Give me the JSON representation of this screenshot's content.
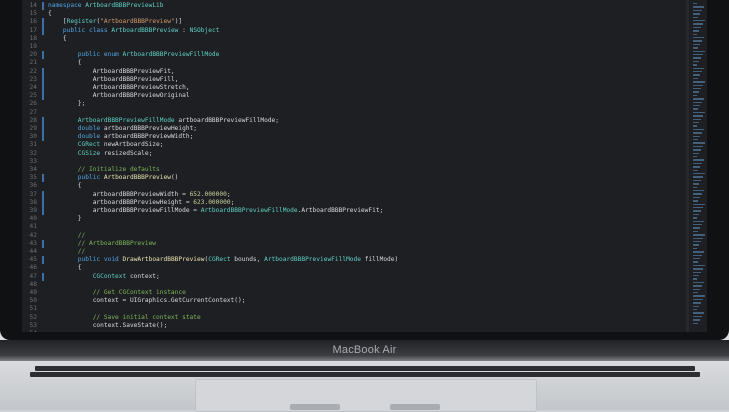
{
  "device": {
    "label": "MacBook Air"
  },
  "editor": {
    "lines": [
      {
        "n": "14",
        "marker": true,
        "segs": [
          {
            "t": "namespace ",
            "c": "kw"
          },
          {
            "t": "ArtboardBBBPreviewLib",
            "c": "ty"
          }
        ]
      },
      {
        "n": "15",
        "marker": false,
        "segs": [
          {
            "t": "{",
            "c": ""
          }
        ]
      },
      {
        "n": "16",
        "marker": true,
        "segs": [
          {
            "t": "    [",
            "c": ""
          },
          {
            "t": "Register",
            "c": "ty"
          },
          {
            "t": "(",
            "c": ""
          },
          {
            "t": "\"ArtboardBBBPreview\"",
            "c": "st"
          },
          {
            "t": ")]",
            "c": ""
          }
        ]
      },
      {
        "n": "17",
        "marker": true,
        "segs": [
          {
            "t": "    public class ",
            "c": "kw"
          },
          {
            "t": "ArtboardBBBPreview",
            "c": "ty"
          },
          {
            "t": " : ",
            "c": ""
          },
          {
            "t": "NSObject",
            "c": "ty"
          }
        ]
      },
      {
        "n": "18",
        "marker": false,
        "segs": [
          {
            "t": "    {",
            "c": ""
          }
        ]
      },
      {
        "n": "19",
        "marker": false,
        "segs": []
      },
      {
        "n": "20",
        "marker": true,
        "segs": [
          {
            "t": "        public enum ",
            "c": "kw"
          },
          {
            "t": "ArtboardBBBPreviewFillMode",
            "c": "ty"
          }
        ]
      },
      {
        "n": "21",
        "marker": false,
        "segs": [
          {
            "t": "        {",
            "c": ""
          }
        ]
      },
      {
        "n": "22",
        "marker": true,
        "segs": [
          {
            "t": "            ArtboardBBBPreviewFit,",
            "c": ""
          }
        ]
      },
      {
        "n": "23",
        "marker": true,
        "segs": [
          {
            "t": "            ArtboardBBBPreviewFill,",
            "c": ""
          }
        ]
      },
      {
        "n": "24",
        "marker": true,
        "segs": [
          {
            "t": "            ArtboardBBBPreviewStretch,",
            "c": ""
          }
        ]
      },
      {
        "n": "25",
        "marker": true,
        "segs": [
          {
            "t": "            ArtboardBBBPreviewOriginal",
            "c": ""
          }
        ]
      },
      {
        "n": "26",
        "marker": false,
        "segs": [
          {
            "t": "        };",
            "c": ""
          }
        ]
      },
      {
        "n": "27",
        "marker": false,
        "segs": []
      },
      {
        "n": "28",
        "marker": true,
        "segs": [
          {
            "t": "        ArtboardBBBPreviewFillMode",
            "c": "ty"
          },
          {
            "t": " artboardBBBPreviewFillMode;",
            "c": ""
          }
        ]
      },
      {
        "n": "29",
        "marker": true,
        "segs": [
          {
            "t": "        double ",
            "c": "kw"
          },
          {
            "t": "artboardBBBPreviewHeight;",
            "c": ""
          }
        ]
      },
      {
        "n": "30",
        "marker": true,
        "segs": [
          {
            "t": "        double ",
            "c": "kw"
          },
          {
            "t": "artboardBBBPreviewWidth;",
            "c": ""
          }
        ]
      },
      {
        "n": "31",
        "marker": false,
        "segs": [
          {
            "t": "        CGRect",
            "c": "ty"
          },
          {
            "t": " newArtboardSize;",
            "c": ""
          }
        ]
      },
      {
        "n": "32",
        "marker": false,
        "segs": [
          {
            "t": "        CGSize",
            "c": "ty"
          },
          {
            "t": " resizedScale;",
            "c": ""
          }
        ]
      },
      {
        "n": "33",
        "marker": false,
        "segs": []
      },
      {
        "n": "34",
        "marker": false,
        "segs": [
          {
            "t": "        // Initialize defaults",
            "c": "cm"
          }
        ]
      },
      {
        "n": "35",
        "marker": true,
        "segs": [
          {
            "t": "        public ",
            "c": "kw"
          },
          {
            "t": "ArtboardBBBPreview",
            "c": "fn"
          },
          {
            "t": "()",
            "c": ""
          }
        ]
      },
      {
        "n": "36",
        "marker": false,
        "segs": [
          {
            "t": "        {",
            "c": ""
          }
        ]
      },
      {
        "n": "37",
        "marker": true,
        "segs": [
          {
            "t": "            artboardBBBPreviewWidth = ",
            "c": ""
          },
          {
            "t": "652.000000",
            "c": "nm"
          },
          {
            "t": ";",
            "c": ""
          }
        ]
      },
      {
        "n": "38",
        "marker": true,
        "segs": [
          {
            "t": "            artboardBBBPreviewHeight = ",
            "c": ""
          },
          {
            "t": "623.000000",
            "c": "nm"
          },
          {
            "t": ";",
            "c": ""
          }
        ]
      },
      {
        "n": "39",
        "marker": true,
        "segs": [
          {
            "t": "            artboardBBBPreviewFillMode = ",
            "c": ""
          },
          {
            "t": "ArtboardBBBPreviewFillMode",
            "c": "ty"
          },
          {
            "t": ".ArtboardBBBPreviewFit;",
            "c": ""
          }
        ]
      },
      {
        "n": "40",
        "marker": false,
        "segs": [
          {
            "t": "        }",
            "c": ""
          }
        ]
      },
      {
        "n": "41",
        "marker": false,
        "segs": []
      },
      {
        "n": "42",
        "marker": false,
        "segs": [
          {
            "t": "        //",
            "c": "cm"
          }
        ]
      },
      {
        "n": "43",
        "marker": true,
        "segs": [
          {
            "t": "        // ArtboardBBBPreview",
            "c": "cm"
          }
        ]
      },
      {
        "n": "44",
        "marker": false,
        "segs": [
          {
            "t": "        //",
            "c": "cm"
          }
        ]
      },
      {
        "n": "45",
        "marker": true,
        "segs": [
          {
            "t": "        public void ",
            "c": "kw"
          },
          {
            "t": "DrawArtboardBBBPreview",
            "c": "fn"
          },
          {
            "t": "(",
            "c": ""
          },
          {
            "t": "CGRect",
            "c": "ty"
          },
          {
            "t": " bounds, ",
            "c": ""
          },
          {
            "t": "ArtboardBBBPreviewFillMode",
            "c": "ty"
          },
          {
            "t": " fillMode)",
            "c": ""
          }
        ]
      },
      {
        "n": "46",
        "marker": false,
        "segs": [
          {
            "t": "        {",
            "c": ""
          }
        ]
      },
      {
        "n": "47",
        "marker": true,
        "segs": [
          {
            "t": "            CGContext",
            "c": "ty"
          },
          {
            "t": " context;",
            "c": ""
          }
        ]
      },
      {
        "n": "48",
        "marker": false,
        "segs": []
      },
      {
        "n": "49",
        "marker": false,
        "segs": [
          {
            "t": "            // Get CGContext instance",
            "c": "cm"
          }
        ]
      },
      {
        "n": "50",
        "marker": false,
        "segs": [
          {
            "t": "            context = UIGraphics.GetCurrentContext();",
            "c": ""
          }
        ]
      },
      {
        "n": "51",
        "marker": false,
        "segs": []
      },
      {
        "n": "52",
        "marker": false,
        "segs": [
          {
            "t": "            // Save initial context state",
            "c": "cm"
          }
        ]
      },
      {
        "n": "53",
        "marker": false,
        "segs": [
          {
            "t": "            context.SaveState();",
            "c": ""
          }
        ]
      },
      {
        "n": "54",
        "marker": false,
        "segs": []
      }
    ]
  }
}
